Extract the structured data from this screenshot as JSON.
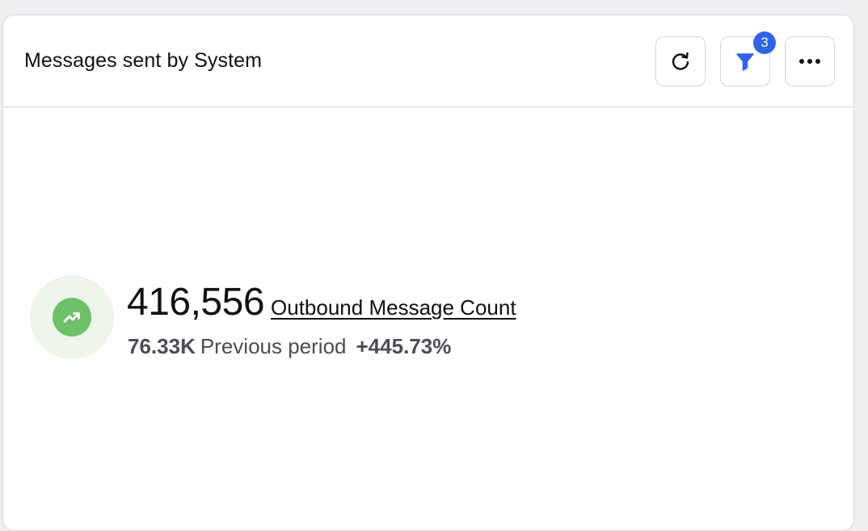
{
  "widget": {
    "title": "Messages sent by System",
    "filter_count": "3"
  },
  "metric": {
    "value": "416,556",
    "label": "Outbound Message Count",
    "previous_value": "76.33K",
    "previous_label": "Previous period",
    "change": "+445.73%",
    "trend": "up"
  },
  "icons": {
    "refresh": "refresh-icon",
    "filter": "filter-icon",
    "more": "more-icon",
    "trend": "trending-up-icon"
  },
  "colors": {
    "accent": "#2f63e8",
    "trend_bg": "#eef6ec",
    "trend_fg": "#6fc06a"
  }
}
